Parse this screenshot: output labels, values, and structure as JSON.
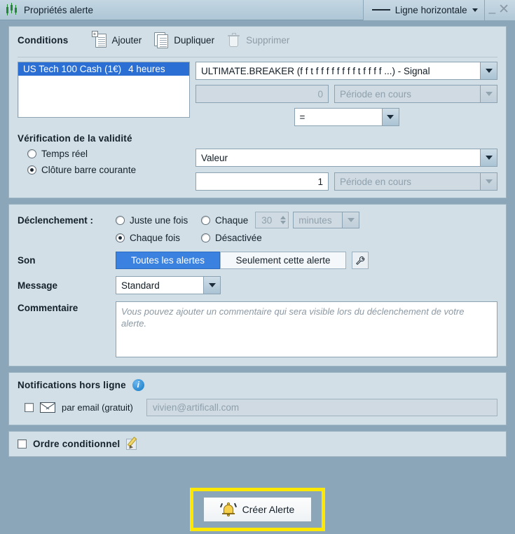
{
  "titlebar": {
    "icon": "candlestick-icon",
    "title": "Propriétés alerte",
    "shape_label": "Ligne horizontale",
    "minimize": "_",
    "close": "✕"
  },
  "conditions": {
    "title": "Conditions",
    "add_label": "Ajouter",
    "duplicate_label": "Dupliquer",
    "delete_label": "Supprimer",
    "instrument": {
      "name": "US Tech 100 Cash (1€)",
      "timeframe": "4 heures"
    },
    "indicator_select": "ULTIMATE.BREAKER (f f t f f f f f f f f t f f f f ...)  - Signal",
    "value_left": "0",
    "period_left": "Période en cours",
    "operator": "=",
    "validity": {
      "title": "Vérification de la validité",
      "realtime_label": "Temps réel",
      "close_label": "Clôture barre courante"
    },
    "right_select": "Valeur",
    "value_right": "1",
    "period_right": "Période en cours"
  },
  "trigger": {
    "label": "Déclenchement :",
    "once_label": "Juste une fois",
    "every_label": "Chaque",
    "every_count": "30",
    "every_unit": "minutes",
    "everytime_label": "Chaque fois",
    "disabled_label": "Désactivée",
    "sound_label": "Son",
    "sound_all": "Toutes les alertes",
    "sound_only": "Seulement cette alerte",
    "sound_settings_icon": "wrench-icon",
    "message_label": "Message",
    "message_value": "Standard",
    "comment_label": "Commentaire",
    "comment_placeholder": "Vous pouvez ajouter un commentaire qui sera visible lors du déclenchement de votre alerte."
  },
  "notifications": {
    "title": "Notifications hors ligne",
    "info_icon": "info-icon",
    "email_label": "par email (gratuit)",
    "email_value": "vivien@artificall.com"
  },
  "conditional_order": {
    "label": "Ordre conditionnel",
    "edit_icon": "pencil-icon"
  },
  "footer": {
    "create_label": "Créer Alerte",
    "bell_icon": "bell-icon",
    "highlight_color": "#ffe800"
  },
  "colors": {
    "window_bg": "#8ba6b8",
    "panel_bg": "#d3dfe6",
    "accent_blue": "#3b82e0",
    "selection_blue": "#2b6fd4"
  }
}
